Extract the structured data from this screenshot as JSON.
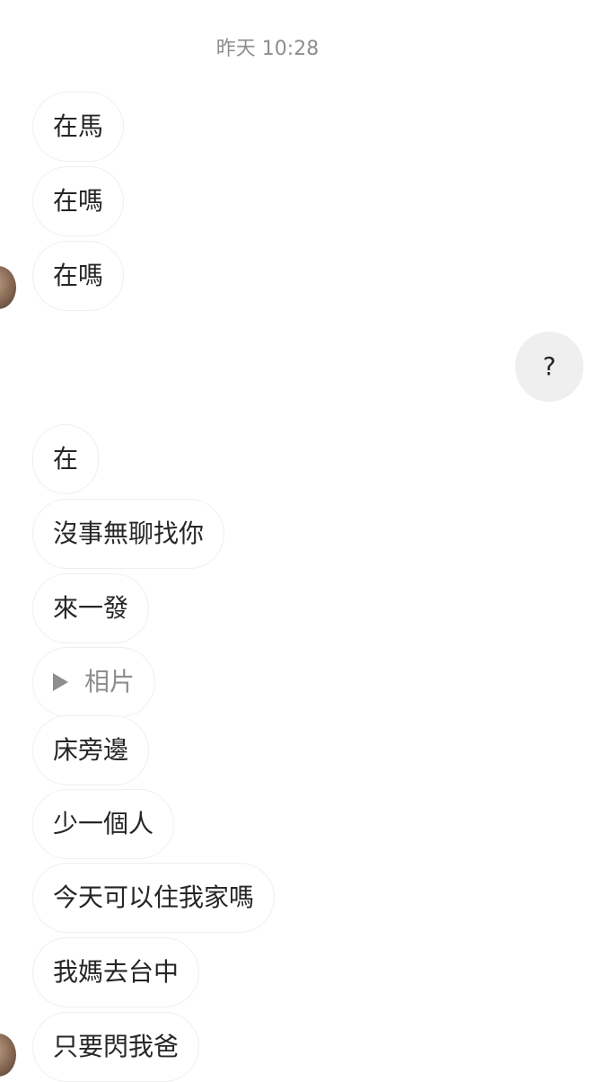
{
  "conversation": {
    "timestamp": "昨天 10:28",
    "messages": [
      {
        "sender": "other",
        "text": "在馬"
      },
      {
        "sender": "other",
        "text": "在嗎"
      },
      {
        "sender": "other",
        "text": "在嗎"
      },
      {
        "sender": "me",
        "text": "?"
      },
      {
        "sender": "other",
        "text": "在"
      },
      {
        "sender": "other",
        "text": "沒事無聊找你"
      },
      {
        "sender": "other",
        "text": "來一發"
      },
      {
        "sender": "other",
        "type": "media",
        "icon": "play-icon",
        "text": "相片"
      },
      {
        "sender": "other",
        "text": "床旁邊"
      },
      {
        "sender": "other",
        "text": "少一個人"
      },
      {
        "sender": "other",
        "text": "今天可以住我家嗎"
      },
      {
        "sender": "other",
        "text": "我媽去台中"
      },
      {
        "sender": "other",
        "text": "只要閃我爸"
      }
    ]
  },
  "colors": {
    "incoming_bubble_border": "#efefef",
    "outgoing_bubble_bg": "#efefef",
    "timestamp_text": "#8e8e8e",
    "message_text": "#262626"
  }
}
